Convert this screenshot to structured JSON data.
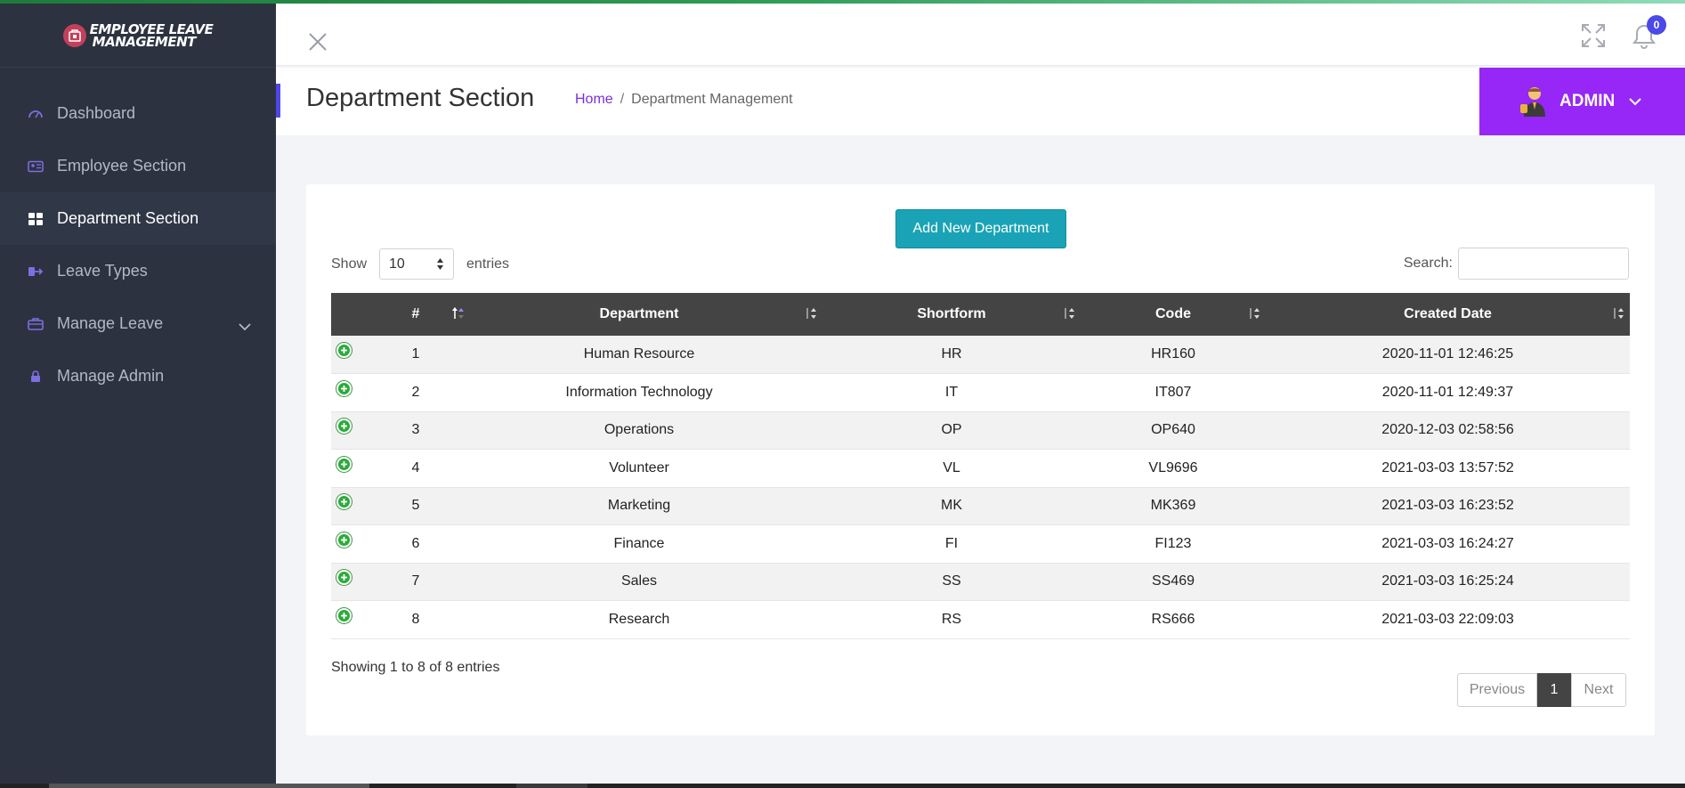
{
  "app": {
    "brand_line1": "Employee Leave",
    "brand_line2": "Management"
  },
  "sidebar": {
    "items": [
      {
        "label": "Dashboard",
        "icon": "dashboard-icon"
      },
      {
        "label": "Employee Section",
        "icon": "id-card-icon"
      },
      {
        "label": "Department Section",
        "icon": "grid-icon",
        "active": true
      },
      {
        "label": "Leave Types",
        "icon": "sign-out-icon"
      },
      {
        "label": "Manage Leave",
        "icon": "briefcase-icon"
      },
      {
        "label": "Manage Admin",
        "icon": "lock-icon"
      }
    ]
  },
  "header": {
    "notification_count": "0"
  },
  "titlebar": {
    "title": "Department Section",
    "breadcrumb_home": "Home",
    "breadcrumb_sep": "/",
    "breadcrumb_current": "Department Management",
    "user": "ADMIN"
  },
  "card": {
    "add_button": "Add New Department",
    "show_label": "Show",
    "page_length": "10",
    "entries_label": "entries",
    "search_label": "Search:",
    "search_value": ""
  },
  "table": {
    "columns": [
      "#",
      "Department",
      "Shortform",
      "Code",
      "Created Date"
    ],
    "rows": [
      [
        "1",
        "Human Resource",
        "HR",
        "HR160",
        "2020-11-01 12:46:25"
      ],
      [
        "2",
        "Information Technology",
        "IT",
        "IT807",
        "2020-11-01 12:49:37"
      ],
      [
        "3",
        "Operations",
        "OP",
        "OP640",
        "2020-12-03 02:58:56"
      ],
      [
        "4",
        "Volunteer",
        "VL",
        "VL9696",
        "2021-03-03 13:57:52"
      ],
      [
        "5",
        "Marketing",
        "MK",
        "MK369",
        "2021-03-03 16:23:52"
      ],
      [
        "6",
        "Finance",
        "FI",
        "FI123",
        "2021-03-03 16:24:27"
      ],
      [
        "7",
        "Sales",
        "SS",
        "SS469",
        "2021-03-03 16:25:24"
      ],
      [
        "8",
        "Research",
        "RS",
        "RS666",
        "2021-03-03 22:09:03"
      ]
    ]
  },
  "footer": {
    "info": "Showing 1 to 8 of 8 entries",
    "prev": "Previous",
    "page": "1",
    "next": "Next"
  },
  "colors": {
    "sidebar_bg": "#2c3240",
    "accent_purple": "#9627f6",
    "button_teal": "#1aa3b6",
    "table_header": "#444444"
  }
}
